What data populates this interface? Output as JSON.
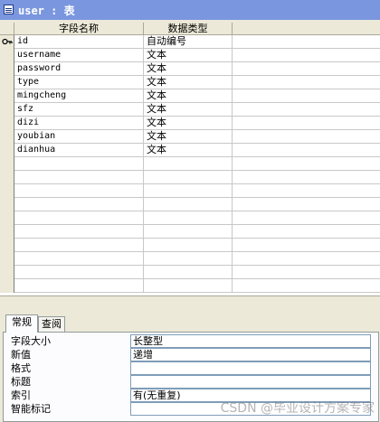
{
  "window": {
    "title": "user : 表"
  },
  "grid": {
    "headers": [
      "字段名称",
      "数据类型",
      ""
    ],
    "rows": [
      {
        "name": "id",
        "type": "自动编号",
        "desc": "",
        "primary_key": true
      },
      {
        "name": "username",
        "type": "文本",
        "desc": ""
      },
      {
        "name": "password",
        "type": "文本",
        "desc": ""
      },
      {
        "name": "type",
        "type": "文本",
        "desc": ""
      },
      {
        "name": "mingcheng",
        "type": "文本",
        "desc": ""
      },
      {
        "name": "sfz",
        "type": "文本",
        "desc": ""
      },
      {
        "name": "dizi",
        "type": "文本",
        "desc": ""
      },
      {
        "name": "youbian",
        "type": "文本",
        "desc": ""
      },
      {
        "name": "dianhua",
        "type": "文本",
        "desc": ""
      }
    ]
  },
  "properties": {
    "tabs": [
      "常规",
      "查阅"
    ],
    "active_tab": "常规",
    "fields": [
      {
        "label": "字段大小",
        "value": "长整型"
      },
      {
        "label": "新值",
        "value": "递增"
      },
      {
        "label": "格式",
        "value": ""
      },
      {
        "label": "标题",
        "value": ""
      },
      {
        "label": "索引",
        "value": "有(无重复)"
      },
      {
        "label": "智能标记",
        "value": ""
      }
    ]
  },
  "watermark": "CSDN @毕业设计方案专家",
  "icons": {
    "window": "table-icon",
    "key": "primary-key-icon"
  }
}
